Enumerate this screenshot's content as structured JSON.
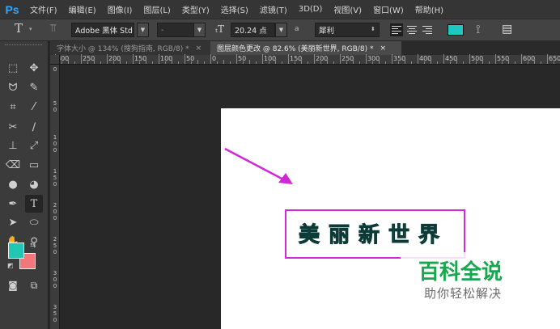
{
  "app": {
    "logo": "Ps"
  },
  "menu": [
    "文件(F)",
    "编辑(E)",
    "图像(I)",
    "图层(L)",
    "类型(Y)",
    "选择(S)",
    "滤镜(T)",
    "3D(D)",
    "视图(V)",
    "窗口(W)",
    "帮助(H)"
  ],
  "options": {
    "tool_glyph": "T",
    "font_family": "Adobe 黑体 Std",
    "font_style": "-",
    "font_size": "20.24 点",
    "aa_label": "a",
    "antialias": "犀利",
    "text_color": "#1ec8c0"
  },
  "tabs": [
    {
      "label": "字体大小 @ 134% (搜狗指南, RGB/8) *",
      "close": "×",
      "active": false
    },
    {
      "label": "图层颜色更改 @ 82.6% (美丽新世界, RGB/8) *",
      "close": "×",
      "active": true
    }
  ],
  "ruler": {
    "h_labels": [
      "300",
      "250",
      "200",
      "150",
      "100",
      "50",
      "0",
      "50",
      "100",
      "150",
      "200",
      "250",
      "300",
      "350",
      "400",
      "450",
      "500",
      "550",
      "600",
      "650"
    ],
    "v_labels": [
      "0",
      "5 0",
      "1 0 0",
      "1 5 0",
      "2 0 0",
      "2 5 0",
      "3 0 0",
      "3 5 0",
      "4 0 0"
    ]
  },
  "canvas": {
    "text": "美丽新世界",
    "text_color": "#2aa89a",
    "frame_color": "#d229d6",
    "arrow_color": "#d229d6"
  },
  "swatches": {
    "foreground": "#20c8b4",
    "background": "#f2777d"
  },
  "watermark": {
    "title": "百科全说",
    "subtitle": "助你轻松解决",
    "color": "#1aa64e"
  }
}
